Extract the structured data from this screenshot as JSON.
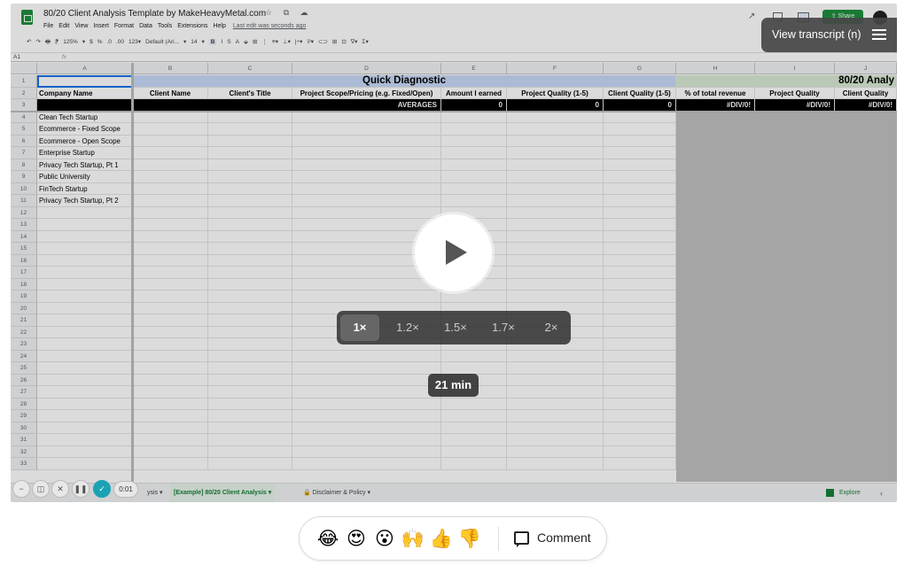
{
  "doc": {
    "title": "80/20 Client Analysis Template by MakeHeavyMetal.com",
    "title_icons": "☆ ⧉ ☁",
    "menu": [
      "File",
      "Edit",
      "View",
      "Insert",
      "Format",
      "Data",
      "Tools",
      "Extensions",
      "Help"
    ],
    "last_edit": "Last edit was seconds ago",
    "share_label": "⇪ Share"
  },
  "toolbar": {
    "items": [
      "↶",
      "↷",
      "🖶",
      "⁋",
      "125%",
      "▾",
      "$",
      "%",
      ".0",
      ".00",
      "123▾",
      "Default (Ari...",
      "▾",
      "14",
      "▾",
      "B",
      "I",
      "S",
      "A",
      "⬙",
      "⊞",
      "⋮",
      "≡▾",
      "⊥▾",
      "|÷▾",
      "⅌▾",
      "⊂⊃",
      "⊞",
      "⊡",
      "∇▾",
      "Σ▾"
    ]
  },
  "formula_bar": {
    "cell_ref": "A1",
    "fx": "fx"
  },
  "grid": {
    "col_letters": [
      "A",
      "B",
      "C",
      "D",
      "E",
      "F",
      "G",
      "H",
      "I",
      "J"
    ],
    "row_numbers": [
      1,
      2,
      3,
      4,
      5,
      6,
      7,
      8,
      9,
      10,
      11,
      12,
      13,
      14,
      15,
      16,
      17,
      18,
      19,
      20,
      21,
      22,
      23,
      24,
      25,
      26,
      27,
      28,
      29,
      30,
      31,
      32,
      33
    ],
    "band1": "Quick Diagnostic",
    "band2": "80/20 Analy",
    "headers": [
      "Company Name",
      "Client Name",
      "Client's Title",
      "Project Scope/Pricing (e.g. Fixed/Open)",
      "Amount I earned",
      "Project Quality (1-5)",
      "Client Quality (1-5)",
      "% of total revenue",
      "Project Quality",
      "Client Quality"
    ],
    "averages_label": "AVERAGES",
    "averages": [
      "0",
      "0",
      "0",
      "#DIV/0!",
      "#DIV/0!",
      "#DIV/0!"
    ],
    "companies": [
      "Clean Tech Startup",
      "Ecommerce - Fixed Scope",
      "Ecommerce - Open Scope",
      "Enterprise Startup",
      "Privacy Tech Startup, Pt 1",
      "Public University",
      "FinTech Startup",
      "Privacy Tech Startup, Pt 2"
    ]
  },
  "tabs": {
    "partial": "ysis ▾",
    "active": "[Example] 80/20 Client Analysis ▾",
    "disclaimer": "🔒 Disclaimer & Policy ▾",
    "explore": "Explore",
    "arrow": "‹"
  },
  "player": {
    "transcript_label": "View transcript (n)",
    "speeds": [
      "1×",
      "1.2×",
      "1.5×",
      "1.7×",
      "2×"
    ],
    "active_speed": "1×",
    "duration": "21 min",
    "elapsed": "0:01",
    "control_icons": {
      "minus": "−",
      "camera": "◫",
      "close": "✕",
      "pause": "❚❚",
      "check": "✓"
    }
  },
  "reactions": {
    "emojis": [
      "😂",
      "😍",
      "😮",
      "🙌",
      "👍",
      "👎"
    ],
    "comment_label": "Comment"
  }
}
